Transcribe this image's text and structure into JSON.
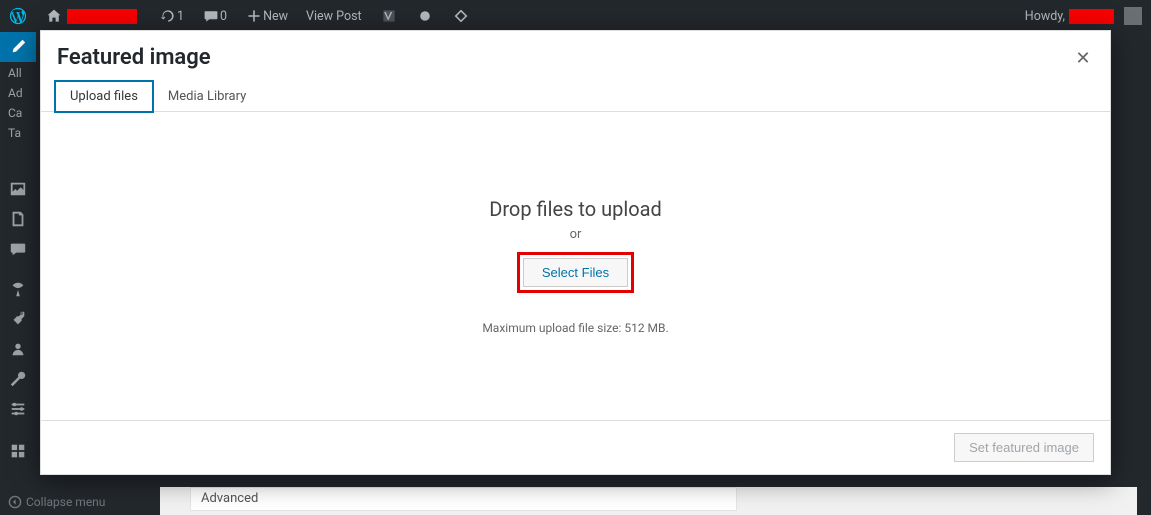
{
  "adminbar": {
    "refresh_count": "1",
    "comment_count": "0",
    "new_label": "New",
    "view_post_label": "View Post",
    "howdy": "Howdy,"
  },
  "sidebar": {
    "sub": {
      "all": "All",
      "add": "Ad",
      "cat": "Ca",
      "tag": "Ta"
    },
    "collapse_label": "Collapse menu"
  },
  "background": {
    "advanced_label": "Advanced"
  },
  "modal": {
    "title": "Featured image",
    "tabs": {
      "upload": "Upload files",
      "library": "Media Library"
    },
    "uploader": {
      "drop_text": "Drop files to upload",
      "or_text": "or",
      "select_button": "Select Files",
      "max_text": "Maximum upload file size: 512 MB."
    },
    "footer": {
      "set_button": "Set featured image"
    }
  }
}
